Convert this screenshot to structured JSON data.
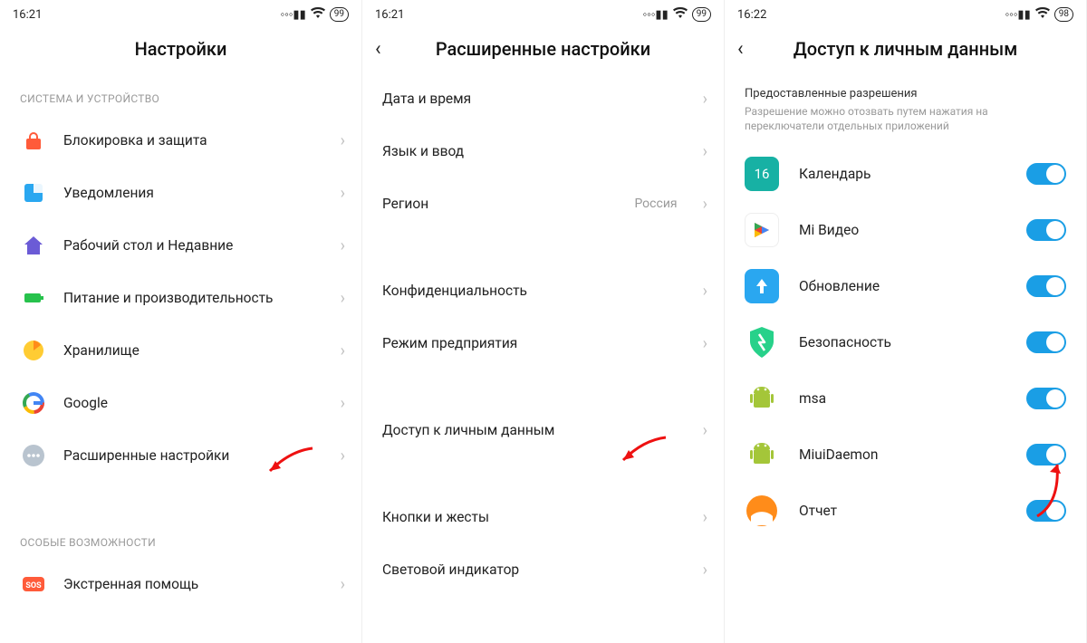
{
  "screens": [
    {
      "status": {
        "time": "16:21",
        "battery": "99"
      },
      "title": "Настройки",
      "sections": [
        {
          "label": "СИСТЕМА И УСТРОЙСТВО",
          "items": [
            {
              "id": "lock",
              "label": "Блокировка и защита"
            },
            {
              "id": "notif",
              "label": "Уведомления"
            },
            {
              "id": "home",
              "label": "Рабочий стол и Недавние"
            },
            {
              "id": "power",
              "label": "Питание и производительность"
            },
            {
              "id": "storage",
              "label": "Хранилище"
            },
            {
              "id": "google",
              "label": "Google"
            },
            {
              "id": "advanced",
              "label": "Расширенные настройки"
            }
          ]
        },
        {
          "label": "ОСОБЫЕ ВОЗМОЖНОСТИ",
          "items": [
            {
              "id": "sos",
              "label": "Экстренная помощь"
            }
          ]
        }
      ]
    },
    {
      "status": {
        "time": "16:21",
        "battery": "99"
      },
      "title": "Расширенные настройки",
      "items": [
        {
          "id": "datetime",
          "label": "Дата и время"
        },
        {
          "id": "lang",
          "label": "Язык и ввод"
        },
        {
          "id": "region",
          "label": "Регион",
          "value": "Россия"
        },
        {
          "gap": true
        },
        {
          "id": "privacy",
          "label": "Конфиденциальность"
        },
        {
          "id": "ent",
          "label": "Режим предприятия"
        },
        {
          "gap": true
        },
        {
          "id": "personal",
          "label": "Доступ к личным данным"
        },
        {
          "gap": true
        },
        {
          "id": "buttons",
          "label": "Кнопки и жесты"
        },
        {
          "id": "led",
          "label": "Световой индикатор"
        }
      ]
    },
    {
      "status": {
        "time": "16:22",
        "battery": "98"
      },
      "title": "Доступ к личным данным",
      "subhead": "Предоставленные разрешения",
      "subdesc": "Разрешение можно отозвать путем нажатия на переключатели отдельных приложений",
      "apps": [
        {
          "id": "calendar",
          "label": "Календарь",
          "iconText": "16",
          "iconBg": "#17b1a4",
          "on": true
        },
        {
          "id": "mivideo",
          "label": "Mi Видео",
          "iconBg": "#ffffff",
          "on": true
        },
        {
          "id": "update",
          "label": "Обновление",
          "iconBg": "#2aa7f0",
          "on": true
        },
        {
          "id": "security",
          "label": "Безопасность",
          "iconBg": "#27d18a",
          "on": true
        },
        {
          "id": "msa",
          "label": "msa",
          "iconBg": "#aed581",
          "on": true
        },
        {
          "id": "daemon",
          "label": "MiuiDaemon",
          "iconBg": "#aed581",
          "on": true
        },
        {
          "id": "report",
          "label": "Отчет",
          "iconBg": "#ff9933",
          "on": true
        }
      ]
    }
  ]
}
